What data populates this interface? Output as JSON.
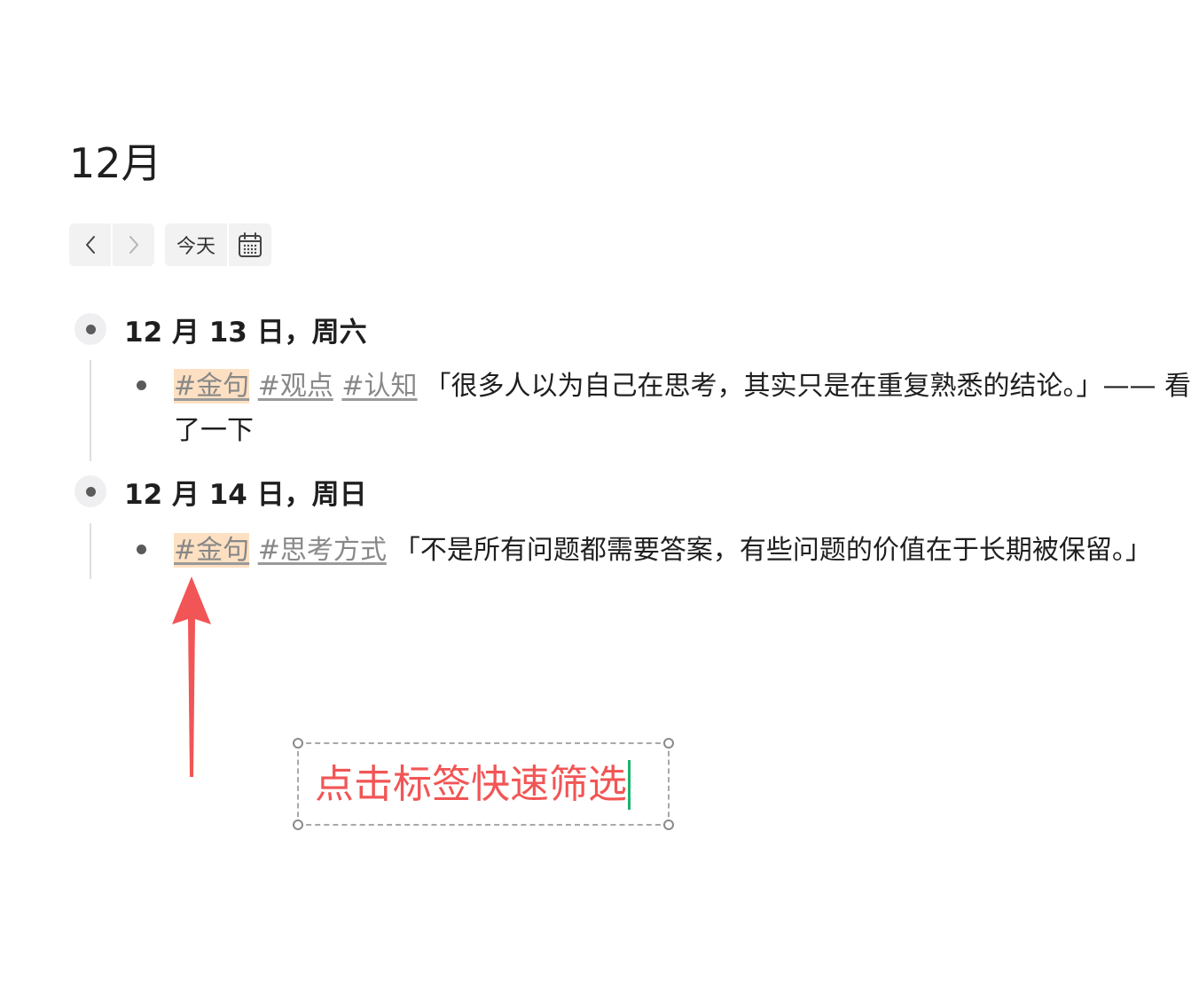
{
  "header": {
    "title": "12月"
  },
  "toolbar": {
    "prev_icon": "chevron-left-icon",
    "next_icon": "chevron-right-icon",
    "today_label": "今天",
    "calendar_icon": "calendar-icon"
  },
  "days": [
    {
      "title": "12 月 13 日，周六",
      "entries": [
        {
          "tags": [
            "#金句",
            "#观点",
            "#认知"
          ],
          "highlighted_tag": "#金句",
          "text_line1": "「很多人以为自己在思考，其实只是在重复熟悉的结论。」—— 看",
          "text_line2": "了一下"
        }
      ]
    },
    {
      "title": "12 月 14 日，周日",
      "entries": [
        {
          "tags": [
            "#金句",
            "#思考方式"
          ],
          "highlighted_tag": "#金句",
          "text_line1": "「不是所有问题都需要答案，有些问题的价值在于长期被保留。」"
        }
      ]
    }
  ],
  "annotation": {
    "text": "点击标签快速筛选",
    "color": "#f25555",
    "arrow_color": "#f25555"
  },
  "colors": {
    "tag_highlight": "#fde0c2",
    "tag_text": "#888888",
    "button_bg": "#f2f2f2"
  }
}
